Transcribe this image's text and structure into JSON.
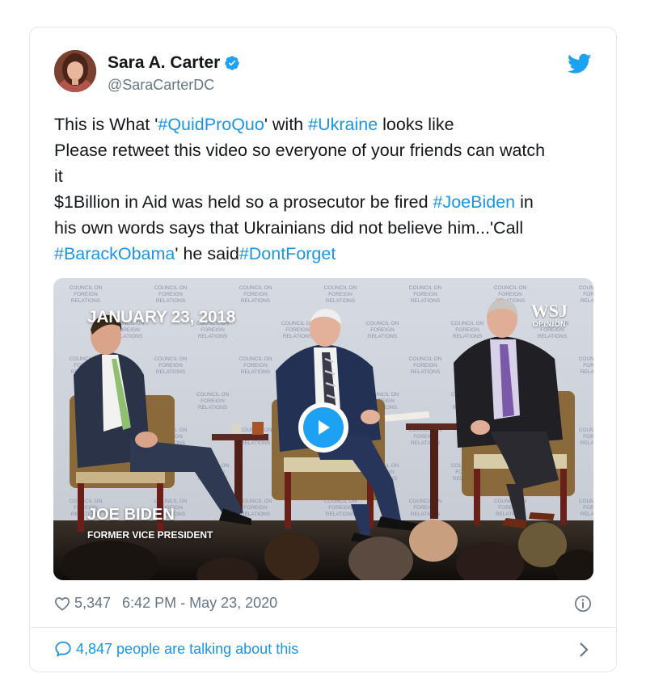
{
  "author": {
    "display_name": "Sara A. Carter",
    "handle": "@SaraCarterDC",
    "avatar_icon": "profile-photo"
  },
  "tweet": {
    "lines": [
      [
        {
          "t": "This is What '"
        },
        {
          "t": "#QuidProQuo",
          "tag": true
        },
        {
          "t": "' with "
        },
        {
          "t": "#Ukraine",
          "tag": true
        },
        {
          "t": " looks like"
        }
      ],
      [
        {
          "t": "Please retweet this video so everyone of your friends can watch"
        }
      ],
      [
        {
          "t": "it"
        }
      ],
      [
        {
          "t": "$1Billion in Aid was held so a prosecutor be fired "
        },
        {
          "t": "#JoeBiden",
          "tag": true
        },
        {
          "t": " in"
        }
      ],
      [
        {
          "t": "his own words says that Ukrainians did not believe him...'Call"
        }
      ],
      [
        {
          "t": "#BarackObama",
          "tag": true
        },
        {
          "t": "' he said"
        },
        {
          "t": "#DontForget",
          "tag": true
        }
      ]
    ]
  },
  "video": {
    "date_overlay": "JANUARY 23, 2018",
    "brand": "WSJ",
    "brand_sub": "OPINION",
    "speaker_name": "JOE BIDEN",
    "speaker_title": "FORMER VICE PRESIDENT",
    "backdrop_text": [
      "COUNCIL ON",
      "FOREIGN",
      "RELATIONS"
    ],
    "play_icon": "play-icon"
  },
  "meta": {
    "likes": "5,347",
    "timestamp": "6:42 PM - May 23, 2020"
  },
  "footer": {
    "talking": "4,847 people are talking about this"
  },
  "colors": {
    "link": "#1b95e0",
    "brand_blue": "#1da1f2",
    "muted": "#657786",
    "border": "#e1e8ed"
  }
}
